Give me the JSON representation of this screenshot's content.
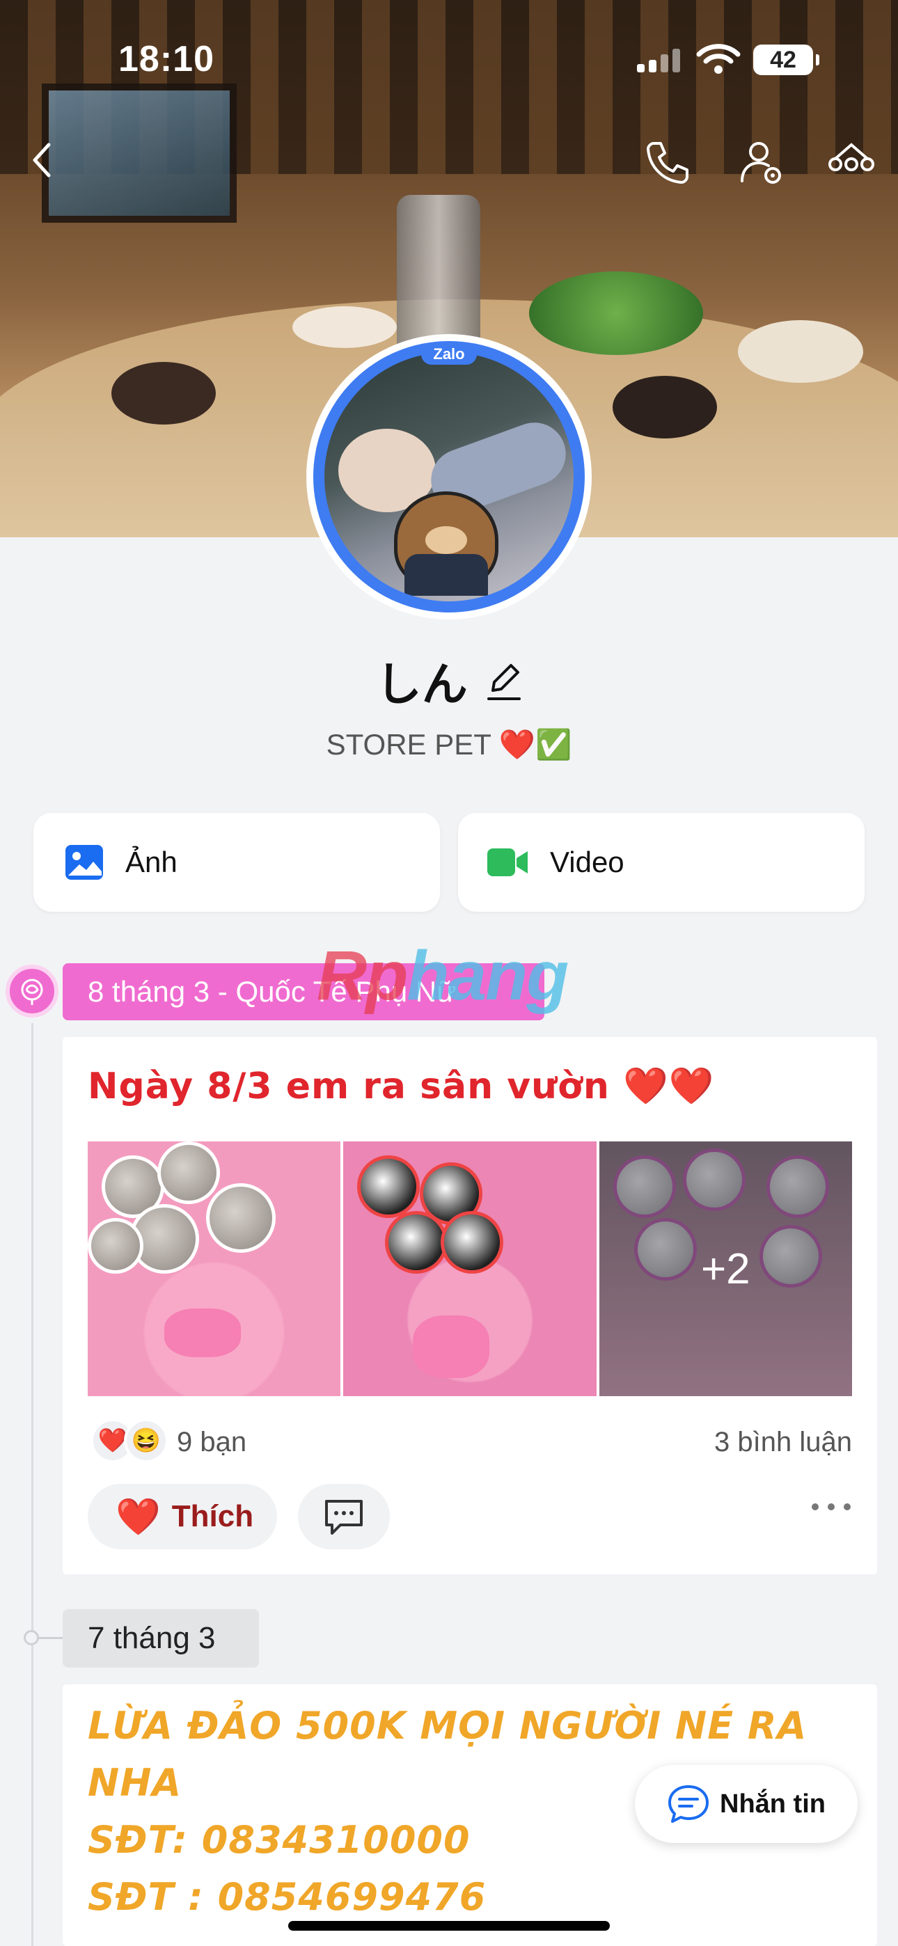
{
  "status_bar": {
    "time": "18:10",
    "battery": "42"
  },
  "profile": {
    "avatar_badge": "Zalo",
    "name": "しん",
    "bio": "STORE PET ❤️✅"
  },
  "media_buttons": {
    "photos": "Ảnh",
    "videos": "Video"
  },
  "watermark": {
    "a": "Rp",
    "b": "hang"
  },
  "timeline": [
    {
      "tag": "8 tháng 3 - Quốc Tế Phụ Nữ",
      "post": {
        "title": "Ngày 8/3 em ra sân vườn ❤️❤️",
        "more_photos": "+2",
        "reactions": [
          "❤️",
          "😆"
        ],
        "reaction_count": "9 bạn",
        "comment_count": "3 bình luận",
        "like_label": "Thích",
        "like_icon": "❤️"
      }
    },
    {
      "tag": "7 tháng 3",
      "post": {
        "lines": [
          "LỪA ĐẢO 500K MỌI NGƯỜI NÉ RA",
          "NHA",
          "SĐT: 0834310000",
          "SĐT : 0854699476"
        ]
      }
    }
  ],
  "message_button": "Nhắn tin",
  "colors": {
    "accent": "#3f7cf2",
    "tag_pink": "#f06bd0",
    "title_red": "#e0252c",
    "warn_orange": "#f0a628"
  }
}
